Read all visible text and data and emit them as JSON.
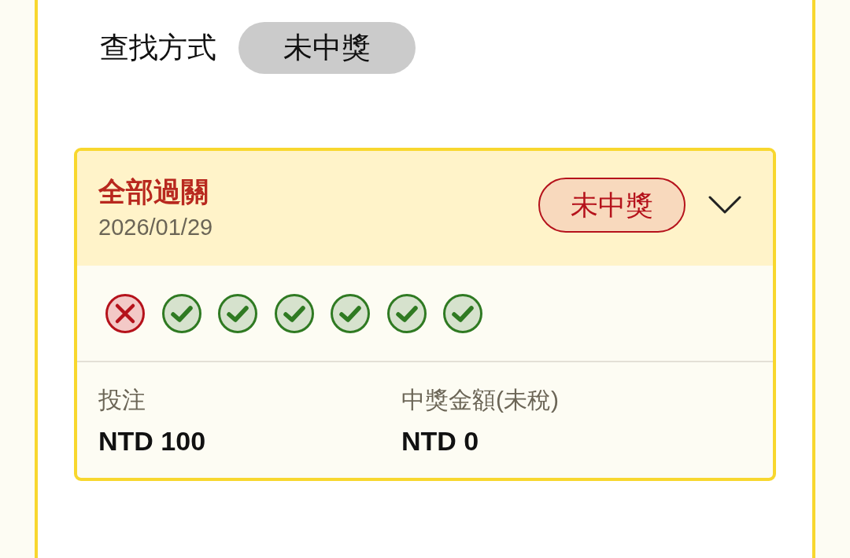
{
  "filter": {
    "label": "查找方式",
    "value": "未中獎"
  },
  "bets": [
    {
      "title": "全部過關",
      "date": "2026/01/29",
      "status": "未中獎",
      "expanded": false,
      "legs": [
        {
          "won": false
        },
        {
          "won": true
        },
        {
          "won": true
        },
        {
          "won": true
        },
        {
          "won": true
        },
        {
          "won": true
        },
        {
          "won": true
        }
      ],
      "stake": {
        "label": "投注",
        "value": "NTD 100"
      },
      "payout": {
        "label": "中獎金額(未稅)",
        "value": "NTD 0"
      }
    }
  ]
}
